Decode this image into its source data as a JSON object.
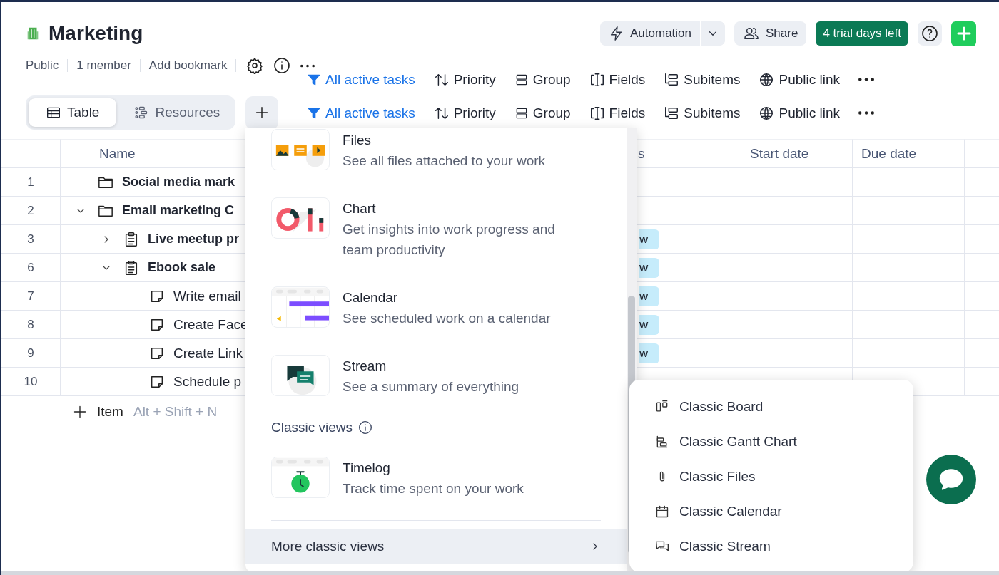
{
  "header": {
    "title": "Marketing",
    "automation": "Automation",
    "share": "Share",
    "trial": "4 trial days left"
  },
  "meta": [
    "Public",
    "1 member",
    "Add bookmark"
  ],
  "toolbars": [
    {
      "items": [
        {
          "kind": "filter",
          "label": "All active tasks"
        },
        {
          "kind": "sort",
          "label": "Priority"
        },
        {
          "kind": "group",
          "label": "Group"
        },
        {
          "kind": "fields",
          "label": "Fields"
        },
        {
          "kind": "subitems",
          "label": "Subitems"
        },
        {
          "kind": "link",
          "label": "Public link"
        }
      ]
    },
    {
      "items": [
        {
          "kind": "filter",
          "label": "All active tasks"
        },
        {
          "kind": "sort",
          "label": "Priority"
        },
        {
          "kind": "group",
          "label": "Group"
        },
        {
          "kind": "fields",
          "label": "Fields"
        },
        {
          "kind": "subitems",
          "label": "Subitems"
        },
        {
          "kind": "link",
          "label": "Public link"
        }
      ]
    }
  ],
  "views": [
    {
      "label": "Table",
      "kind": "table",
      "selected": true
    },
    {
      "label": "Resources",
      "kind": "resources",
      "selected": false
    }
  ],
  "table": {
    "columns": [
      "Name",
      "s",
      "Start date",
      "Due date"
    ],
    "rows": [
      {
        "number": "1",
        "name": "Social media mark",
        "kind": "folder"
      },
      {
        "number": "2",
        "name": "Email marketing C",
        "kind": "folder",
        "expanded": true,
        "children": [
          {
            "number": "3",
            "name": "Live meetup pr",
            "kind": "project",
            "expanded": false,
            "status": "w"
          },
          {
            "number": "6",
            "name": "Ebook sale",
            "kind": "project",
            "expanded": true,
            "status": "w",
            "children": [
              {
                "number": "7",
                "name": "Write email",
                "kind": "task",
                "status": "w"
              },
              {
                "number": "8",
                "name": "Create Face",
                "kind": "task",
                "status": "w"
              },
              {
                "number": "9",
                "name": "Create Link",
                "kind": "task",
                "status": "w"
              },
              {
                "number": "10",
                "name": "Schedule p",
                "kind": "task"
              }
            ]
          }
        ]
      }
    ],
    "add_item": {
      "label": "Item",
      "shortcut": "Alt + Shift + N"
    }
  },
  "menu": {
    "items": [
      {
        "kind": "files",
        "title": "Files",
        "description": "See all files attached to your work"
      },
      {
        "kind": "chart",
        "title": "Chart",
        "description": "Get insights into work progress and team productivity"
      },
      {
        "kind": "calendar",
        "title": "Calendar",
        "description": "See scheduled work on a calendar"
      },
      {
        "kind": "stream",
        "title": "Stream",
        "description": "See a summary of everything"
      }
    ],
    "section": "Classic views",
    "classic_items": [
      {
        "kind": "timelog",
        "title": "Timelog",
        "description": "Track time spent on your work"
      }
    ],
    "more": {
      "label": "More classic views",
      "highlighted": true
    }
  },
  "submenu": [
    {
      "kind": "board",
      "label": "Classic Board"
    },
    {
      "kind": "gantt",
      "label": "Classic Gantt Chart"
    },
    {
      "kind": "files",
      "label": "Classic Files"
    },
    {
      "kind": "calendar",
      "label": "Classic Calendar"
    },
    {
      "kind": "stream",
      "label": "Classic Stream"
    }
  ]
}
